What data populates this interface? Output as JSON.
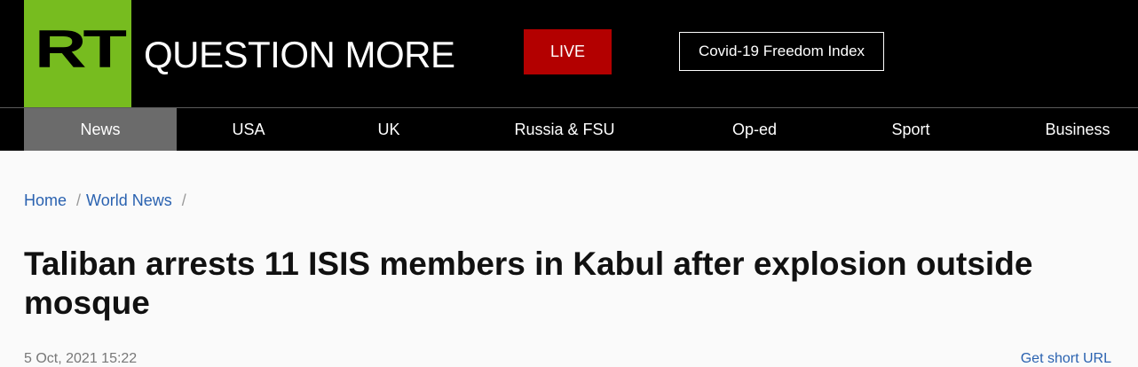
{
  "header": {
    "logo_text": "RT",
    "tagline": "QUESTION MORE",
    "live_label": "LIVE",
    "covid_label": "Covid-19 Freedom Index"
  },
  "nav": {
    "items": [
      {
        "label": "News",
        "active": true
      },
      {
        "label": "USA"
      },
      {
        "label": "UK"
      },
      {
        "label": "Russia & FSU"
      },
      {
        "label": "Op-ed"
      },
      {
        "label": "Sport"
      },
      {
        "label": "Business"
      }
    ]
  },
  "breadcrumb": {
    "items": [
      "Home",
      "World News"
    ],
    "separator": "/"
  },
  "article": {
    "headline": "Taliban arrests 11 ISIS members in Kabul after explosion outside mosque",
    "date": "5 Oct, 2021 15:22",
    "short_url_label": "Get short URL"
  },
  "colors": {
    "brand_green": "#77bc1f",
    "live_red": "#b30000",
    "link_blue": "#2a62b0"
  }
}
